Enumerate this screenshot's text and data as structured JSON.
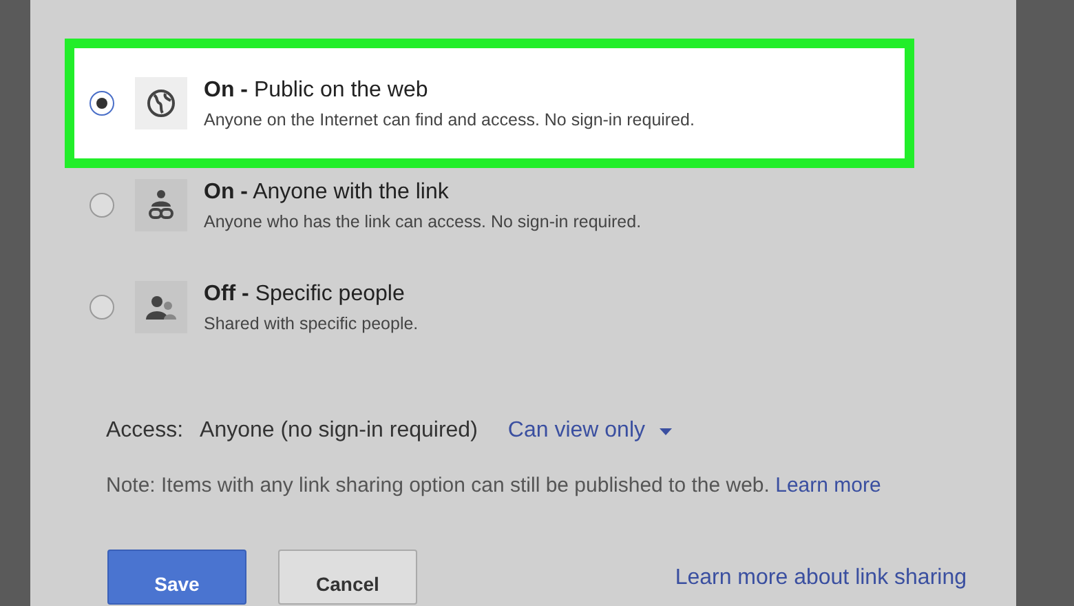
{
  "options": [
    {
      "kind": "public",
      "title": "**On -** Public on the web",
      "description": "Anyone on the Internet can find and access. No sign-in required.",
      "selected": true
    },
    {
      "kind": "link",
      "title": "**On -** Anyone with the link",
      "description": "Anyone who has the link can access. No sign-in required.",
      "selected": false
    },
    {
      "kind": "private",
      "title": "**Off -** Specific people",
      "description": "Shared with specific people.",
      "selected": false
    }
  ],
  "access": {
    "label": "Access:",
    "value": "Anyone (no sign-in required)",
    "dropdown": "Can view only"
  },
  "note": {
    "text": "Note: Items with any link sharing option can still be published to the web.",
    "link": "Learn more"
  },
  "buttons": [
    "Save",
    "Cancel"
  ],
  "help_link": "Learn more about link sharing"
}
